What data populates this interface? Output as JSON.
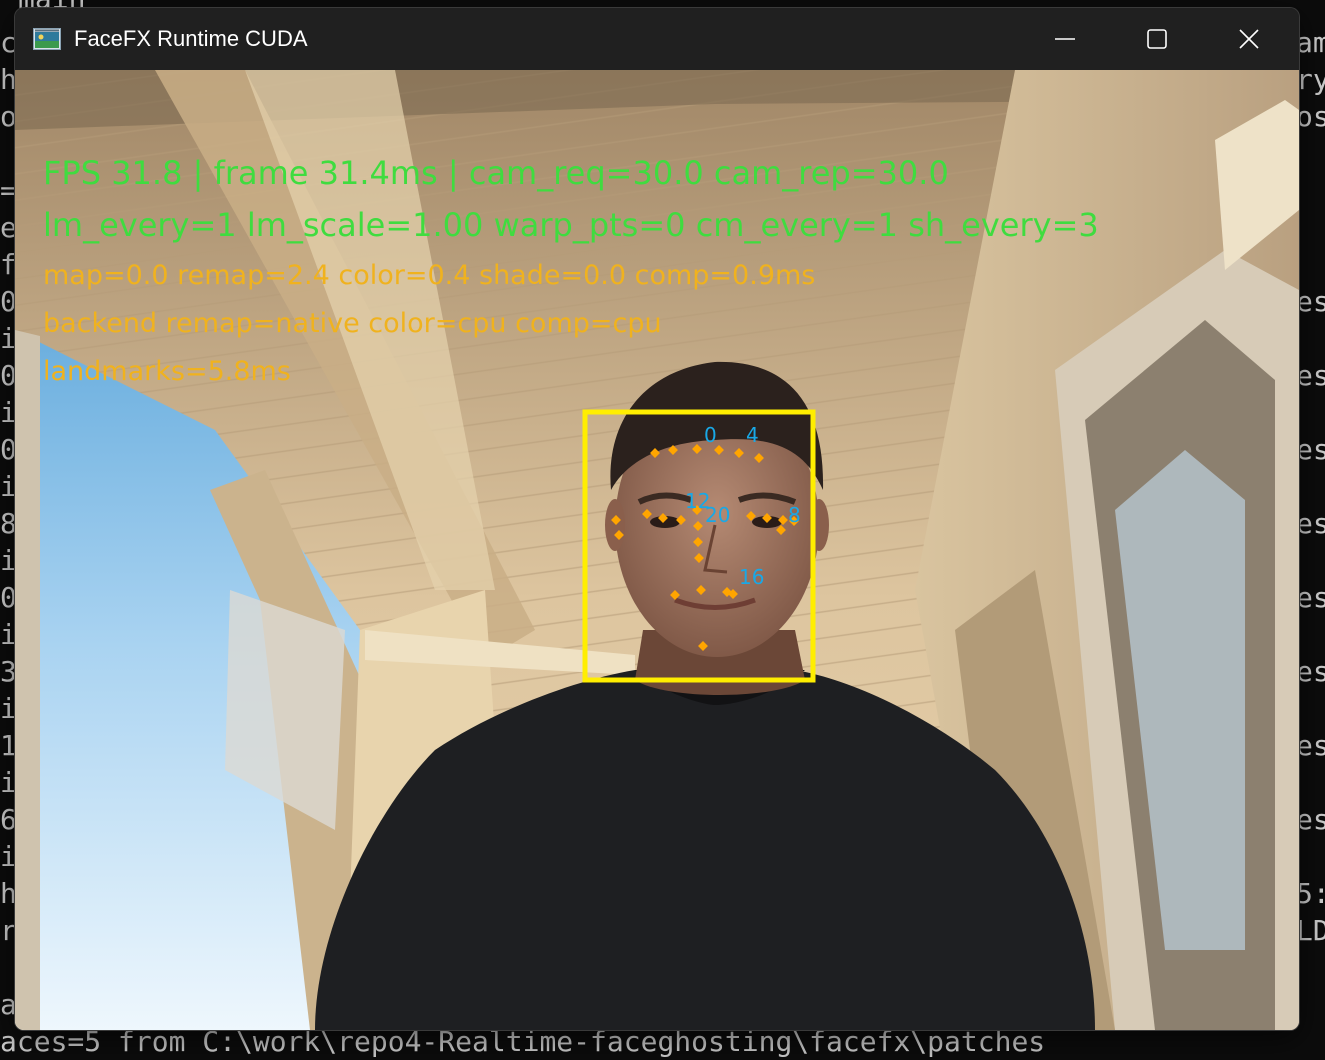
{
  "window": {
    "title": "FaceFX Runtime CUDA",
    "controls": {
      "minimize": "minimize-icon",
      "maximize": "maximize-icon",
      "close": "close-icon"
    }
  },
  "terminal": {
    "top_text": "main",
    "left_chars": [
      "c",
      "h",
      "o",
      "",
      "=",
      "e",
      "f",
      "0",
      "i",
      "0",
      "i",
      "0",
      "i",
      "8",
      "i",
      "0",
      "i",
      "3",
      "i",
      "1",
      "i",
      "6",
      "i",
      "h",
      "r",
      "",
      "a"
    ],
    "right_chars": [
      "am",
      "ry",
      "os",
      "",
      "",
      "",
      "",
      "es",
      "",
      "es",
      "",
      "es",
      "",
      "es",
      "",
      "es",
      "",
      "es",
      "",
      "es",
      "",
      "es",
      "",
      "5:",
      "LD"
    ],
    "bottom_text": "aces=5 from C:\\work\\repo4-Realtime-faceghosting\\facefx\\patches"
  },
  "hud": {
    "line1": "FPS 31.8 | frame  31.4ms | cam_req=30.0 cam_rep=30.0",
    "line2": "lm_every=1 lm_scale=1.00 warp_pts=0 cm_every=1 sh_every=3",
    "line3": "map=0.0 remap=2.4 color=0.4 shade=0.0 comp=0.9ms",
    "line4": "backend remap=native color=cpu comp=cpu",
    "line5": "landmarks=5.8ms"
  },
  "overlay": {
    "box_color": "#ffee00",
    "point_color": "#ffa500",
    "label_color": "#19a8e6",
    "labels": [
      "0",
      "4",
      "12",
      "20",
      "8",
      "16"
    ]
  }
}
